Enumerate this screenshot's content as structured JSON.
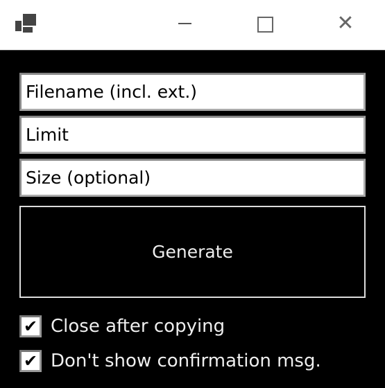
{
  "window": {
    "icons": [
      "app-icon",
      "minimize-icon",
      "maximize-icon",
      "close-icon"
    ],
    "close_glyph": "✕"
  },
  "form": {
    "filename_placeholder": "Filename (incl. ext.)",
    "limit_placeholder": "Limit",
    "size_placeholder": "Size (optional)",
    "generate_label": "Generate"
  },
  "options": [
    {
      "label": "Close after copying",
      "checked": true
    },
    {
      "label": "Don't show confirmation msg.",
      "checked": true
    }
  ],
  "check_glyph": "✔"
}
